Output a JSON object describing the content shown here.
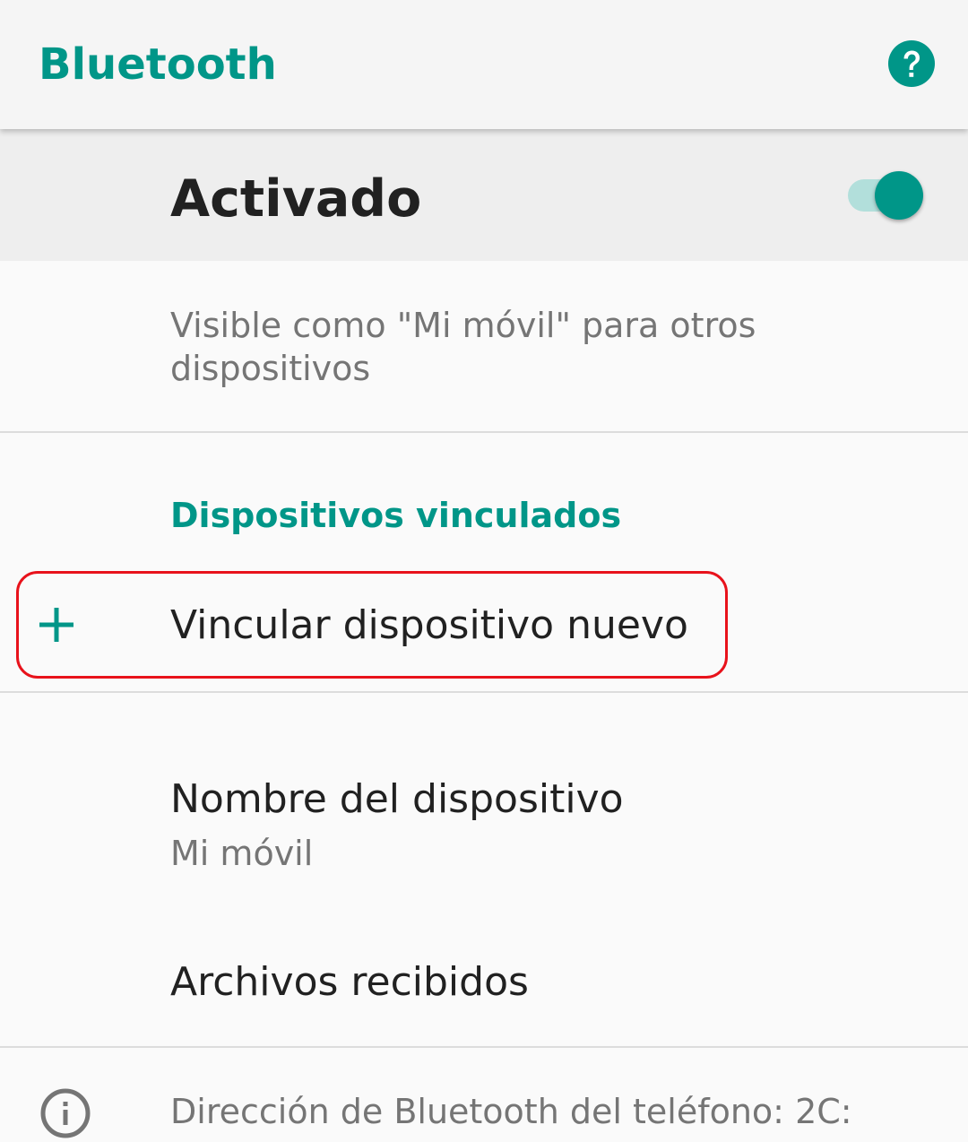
{
  "appbar": {
    "title": "Bluetooth",
    "help_icon": "help-circle-icon"
  },
  "master_switch": {
    "label": "Activado",
    "checked": true
  },
  "visibility": {
    "text": "Visible como \"Mi móvil\" para otros dispositivos"
  },
  "paired_category": {
    "title": "Dispositivos vinculados"
  },
  "pair_new": {
    "icon": "plus-icon",
    "label": "Vincular dispositivo nuevo"
  },
  "device_name": {
    "title": "Nombre del dispositivo",
    "value": "Mi móvil"
  },
  "received_files": {
    "title": "Archivos recibidos"
  },
  "footer": {
    "icon": "info-icon",
    "address_text": "Dirección de Bluetooth del teléfono: 2C:"
  },
  "colors": {
    "accent": "#009688",
    "accent_light": "#b2dfdb",
    "highlight": "#e8121b",
    "primary_text": "#212121",
    "secondary_text": "#757575"
  }
}
